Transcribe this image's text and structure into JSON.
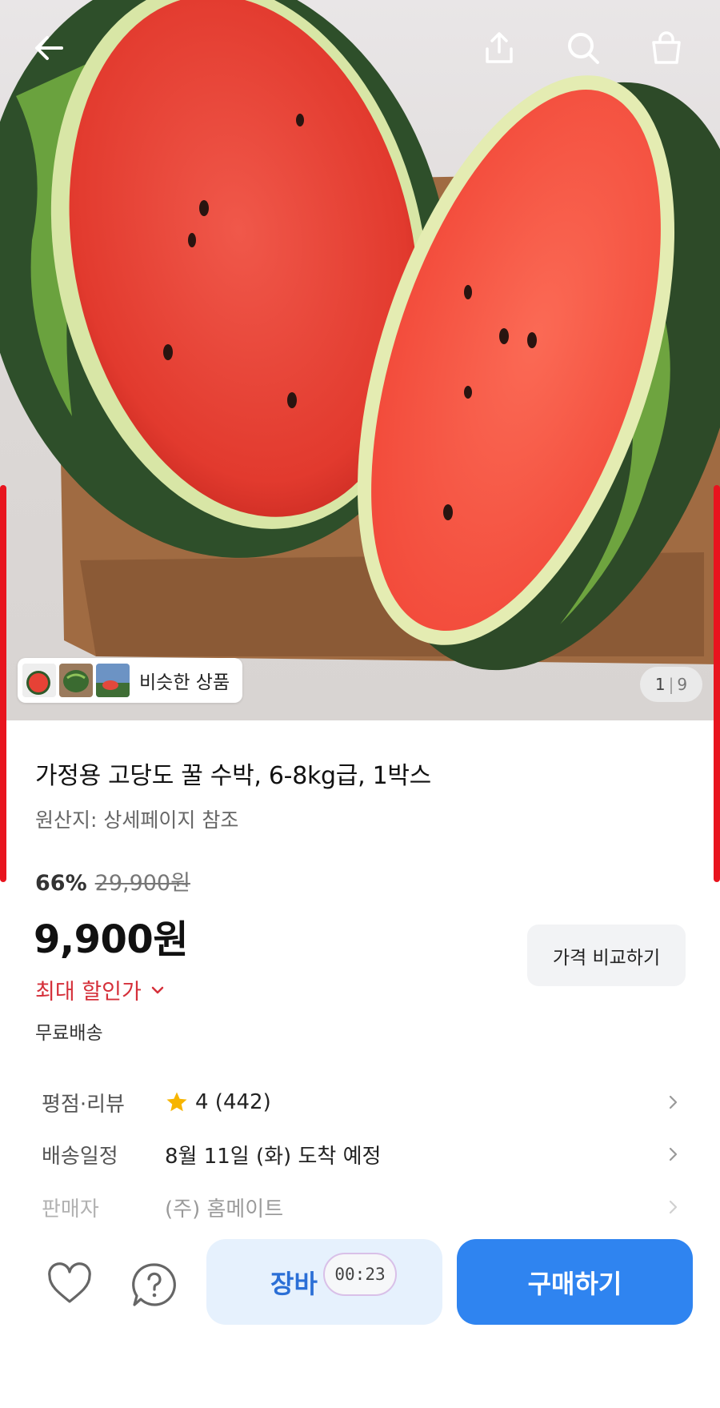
{
  "header": {
    "back_icon": "arrow-left-icon",
    "share_icon": "share-icon",
    "search_icon": "search-icon",
    "cart_icon": "shopping-bag-icon"
  },
  "gallery": {
    "similar_label": "비슷한 상품",
    "current": "1",
    "total": "9"
  },
  "product": {
    "title": "가정용 고당도 꿀 수박, 6-8kg급, 1박스",
    "origin": "원산지: 상세페이지 참조",
    "discount_pct": "66%",
    "original_price": "29,900원",
    "price": "9,900원",
    "compare_label": "가격 비교하기",
    "max_discount_label": "최대 할인가",
    "shipping_label": "무료배송"
  },
  "details": [
    {
      "key": "평점·리뷰",
      "value": "4 (442)"
    },
    {
      "key": "배송일정",
      "value": "8월 11일 (화) 도착 예정"
    },
    {
      "key": "판매자",
      "value": "(주) 홈메이트"
    }
  ],
  "bottom_bar": {
    "like_icon": "heart-icon",
    "help_icon": "question-icon",
    "cart_label": "장바",
    "timer": "00:23",
    "buy_label": "구매하기"
  },
  "colors": {
    "accent_blue": "#2f84f0",
    "discount_red": "#d5303a",
    "edge_red": "#e8141e"
  }
}
